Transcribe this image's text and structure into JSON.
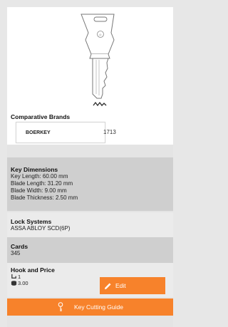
{
  "comparative_brands": {
    "title": "Comparative Brands",
    "brand": "BOERKEY",
    "code": "1713"
  },
  "key_dimensions": {
    "title": "Key Dimensions",
    "lines": [
      "Key Length: 60.00 mm",
      "Blade Length: 31.20 mm",
      "Blade Width: 9.00 mm",
      "Blade Thickness: 2.50 mm"
    ]
  },
  "lock_systems": {
    "title": "Lock Systems",
    "value": "ASSA ABLOY SCD(6P)"
  },
  "cards": {
    "title": "Cards",
    "value": "345"
  },
  "hook_and_price": {
    "title": "Hook and Price",
    "hook": "1",
    "price": "3.00",
    "edit_label": "Edit"
  },
  "key_cutting_guide": {
    "label": "Key Cutting Guide"
  },
  "colors": {
    "accent": "#f7822b",
    "row_dark": "#cfcfcf",
    "row_light": "#ebebeb"
  },
  "icons": [
    "key-image",
    "hook-icon",
    "coins-icon",
    "pencil-icon",
    "key-icon"
  ]
}
